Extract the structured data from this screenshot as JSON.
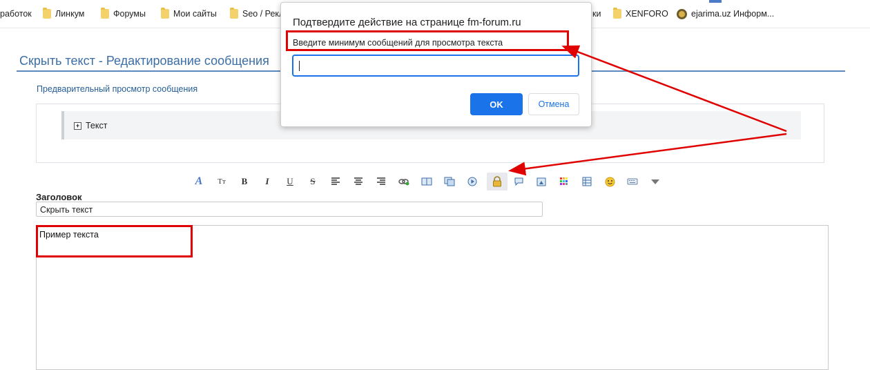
{
  "bookmarks": [
    {
      "label": "работок",
      "icon": "none"
    },
    {
      "label": "Линкум",
      "icon": "folder-icon"
    },
    {
      "label": "Форумы",
      "icon": "folder-icon"
    },
    {
      "label": "Мои сайты",
      "icon": "folder-icon"
    },
    {
      "label": "Seo / Рекл",
      "icon": "folder-icon"
    },
    {
      "label": "ки",
      "icon": "none"
    },
    {
      "label": "XENFORO",
      "icon": "folder-icon"
    },
    {
      "label": "ejarima.uz Информ...",
      "icon": "globe-icon"
    }
  ],
  "page": {
    "title": "Скрыть текст - Редактирование сообщения",
    "preview_label": "Предварительный просмотр сообщения",
    "spoiler_label": "Текст",
    "field_label": "Заголовок",
    "title_value": "Скрыть текст",
    "editor_text": "Пример текста"
  },
  "toolbar": {
    "items": [
      "font-icon",
      "text-size-icon",
      "bold-icon",
      "italic-icon",
      "underline-icon",
      "strikethrough-icon",
      "align-left-icon",
      "align-center-icon",
      "align-right-icon",
      "link-icon",
      "book-icon",
      "copy-icon",
      "media-icon",
      "lock-icon",
      "speech-bubble-icon",
      "image-icon",
      "color-grid-icon",
      "table-icon",
      "smiley-icon",
      "keyboard-icon",
      "more-dropdown-icon"
    ],
    "glyph_tt": "Tт",
    "glyph_b": "B",
    "glyph_i": "I",
    "glyph_u": "U",
    "glyph_s": "S",
    "active": "lock-icon"
  },
  "dialog": {
    "title": "Подтвердите действие на странице fm-forum.ru",
    "message": "Введите минимум сообщений для просмотра текста",
    "input_value": "",
    "ok_label": "OK",
    "cancel_label": "Отмена"
  },
  "colors": {
    "accent": "#1a73e8",
    "annotation_red": "#e00000",
    "title_blue": "#3b6ea5"
  }
}
